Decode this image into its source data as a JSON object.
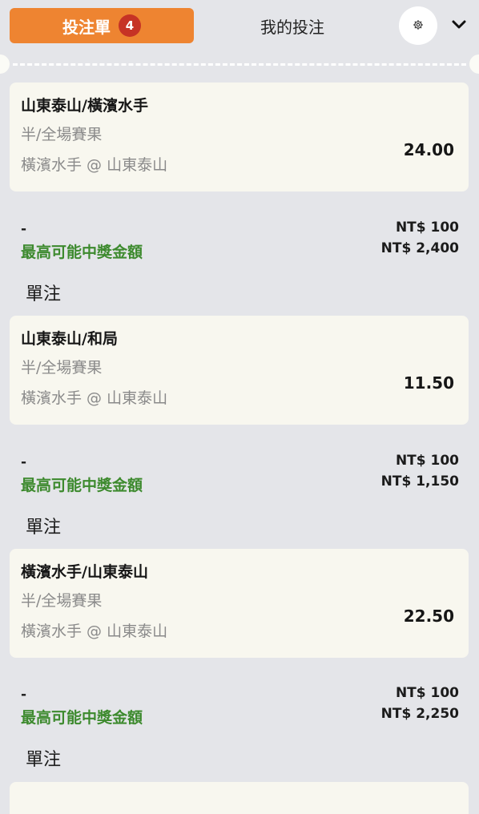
{
  "header": {
    "betslip_label": "投注單",
    "betslip_count": "4",
    "mybets_label": "我的投注",
    "settings_icon": "gear-icon",
    "collapse_icon": "chevron-down-icon"
  },
  "bets": [
    {
      "selection": "山東泰山/橫濱水手",
      "market": "半/全場賽果",
      "event": "橫濱水手 @ 山東泰山",
      "odds": "24.00",
      "dash": "-",
      "stake": "NT$ 100",
      "max_label": "最高可能中獎金額",
      "max_payout": "NT$ 2,400",
      "type_label": "單注"
    },
    {
      "selection": "山東泰山/和局",
      "market": "半/全場賽果",
      "event": "橫濱水手 @ 山東泰山",
      "odds": "11.50",
      "dash": "-",
      "stake": "NT$ 100",
      "max_label": "最高可能中獎金額",
      "max_payout": "NT$ 1,150",
      "type_label": "單注"
    },
    {
      "selection": "橫濱水手/山東泰山",
      "market": "半/全場賽果",
      "event": "橫濱水手 @ 山東泰山",
      "odds": "22.50",
      "dash": "-",
      "stake": "NT$ 100",
      "max_label": "最高可能中獎金額",
      "max_payout": "NT$ 2,250",
      "type_label": "單注"
    }
  ],
  "colors": {
    "accent": "#ee8431",
    "badge": "#c63325",
    "payout_label": "#3d8a2e",
    "card_bg": "#f8f7ef",
    "page_bg": "#e4e5e9"
  }
}
